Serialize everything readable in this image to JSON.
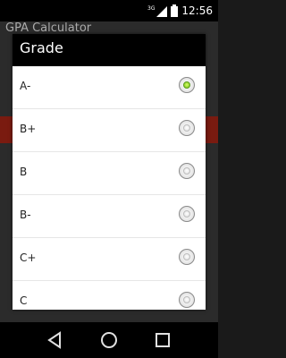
{
  "status_bar": {
    "network": "3G",
    "time": "12:56"
  },
  "background_app": {
    "title": "GPA Calculator"
  },
  "dialog": {
    "title": "Grade",
    "selected": "A-",
    "options": [
      {
        "label": "A-",
        "checked": true
      },
      {
        "label": "B+",
        "checked": false
      },
      {
        "label": "B",
        "checked": false
      },
      {
        "label": "B-",
        "checked": false
      },
      {
        "label": "C+",
        "checked": false
      },
      {
        "label": "C",
        "checked": false
      }
    ]
  },
  "colors": {
    "accent_selected": "#8fd12a",
    "header_bg": "#000000",
    "dialog_bg": "#ffffff"
  },
  "nav": {
    "back_icon": "triangle-back-icon",
    "home_icon": "circle-home-icon",
    "recents_icon": "square-recents-icon"
  }
}
